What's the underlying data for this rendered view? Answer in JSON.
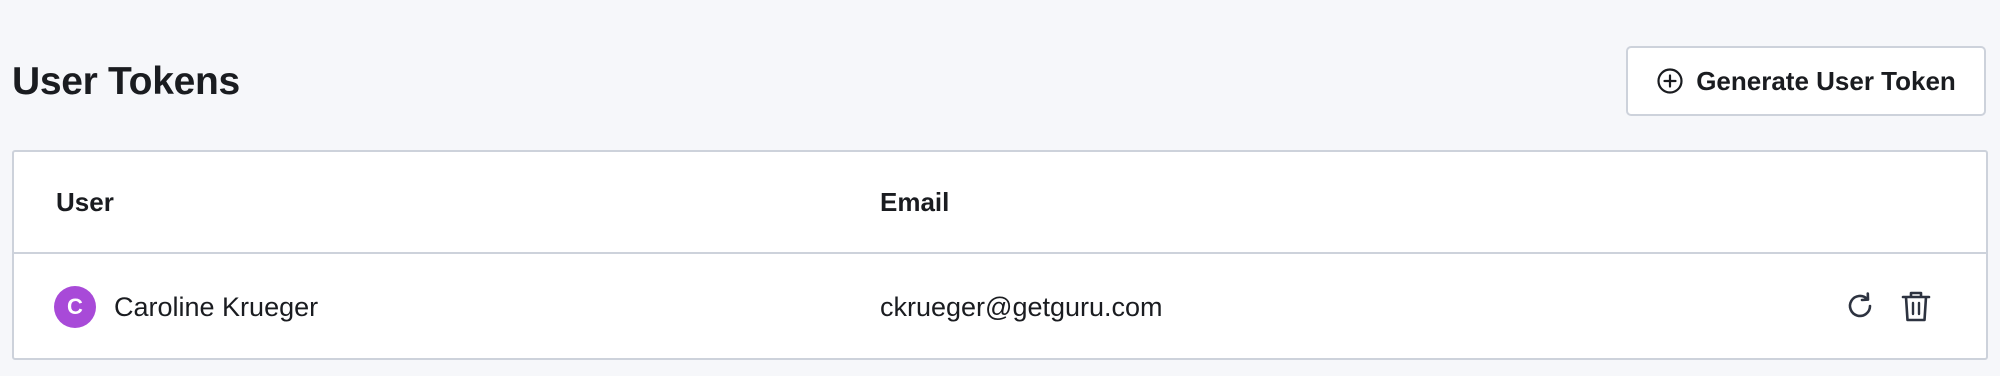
{
  "page": {
    "title": "User Tokens"
  },
  "toolbar": {
    "generate_label": "Generate User Token",
    "generate_icon": "plus-circle-icon"
  },
  "table": {
    "columns": [
      "User",
      "Email"
    ],
    "rows": [
      {
        "avatar_initial": "C",
        "avatar_color": "#a84ad8",
        "name": "Caroline Krueger",
        "email": "ckrueger@getguru.com",
        "actions": [
          "refresh-icon",
          "trash-icon"
        ]
      }
    ]
  },
  "colors": {
    "background": "#f6f7fa",
    "border": "#cdd2db",
    "text": "#1a1c20",
    "icon": "#2d3340"
  }
}
